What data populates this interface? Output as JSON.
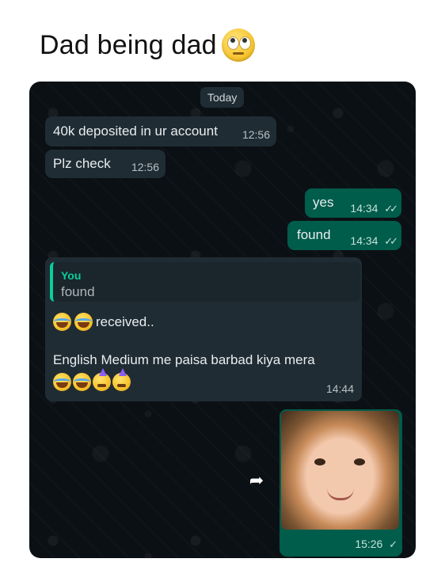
{
  "caption": {
    "text": "Dad being dad",
    "emoji_icon": "face-with-rolling-eyes-icon"
  },
  "chat": {
    "date_separator": "Today",
    "messages": [
      {
        "direction": "incoming",
        "text": "40k deposited in ur account",
        "time": "12:56"
      },
      {
        "direction": "incoming",
        "text": "Plz check",
        "time": "12:56"
      },
      {
        "direction": "outgoing",
        "text": "yes",
        "time": "14:34",
        "status": "read"
      },
      {
        "direction": "outgoing",
        "text": "found",
        "time": "14:34",
        "status": "read"
      },
      {
        "direction": "incoming",
        "quote": {
          "author": "You",
          "text": "found"
        },
        "line1": "received..",
        "line2": "English Medium me paisa barbad kiya mera",
        "time": "14:44"
      },
      {
        "direction": "outgoing",
        "type": "image",
        "time": "15:26",
        "status": "sent"
      }
    ]
  },
  "colors": {
    "incoming_bubble": "#1f2c34",
    "outgoing_bubble": "#005c4b",
    "chat_background": "#0b1014",
    "quote_accent": "#06cf9c"
  },
  "icons": {
    "double_tick": "✓✓",
    "single_tick": "✓",
    "forward": "➦"
  }
}
